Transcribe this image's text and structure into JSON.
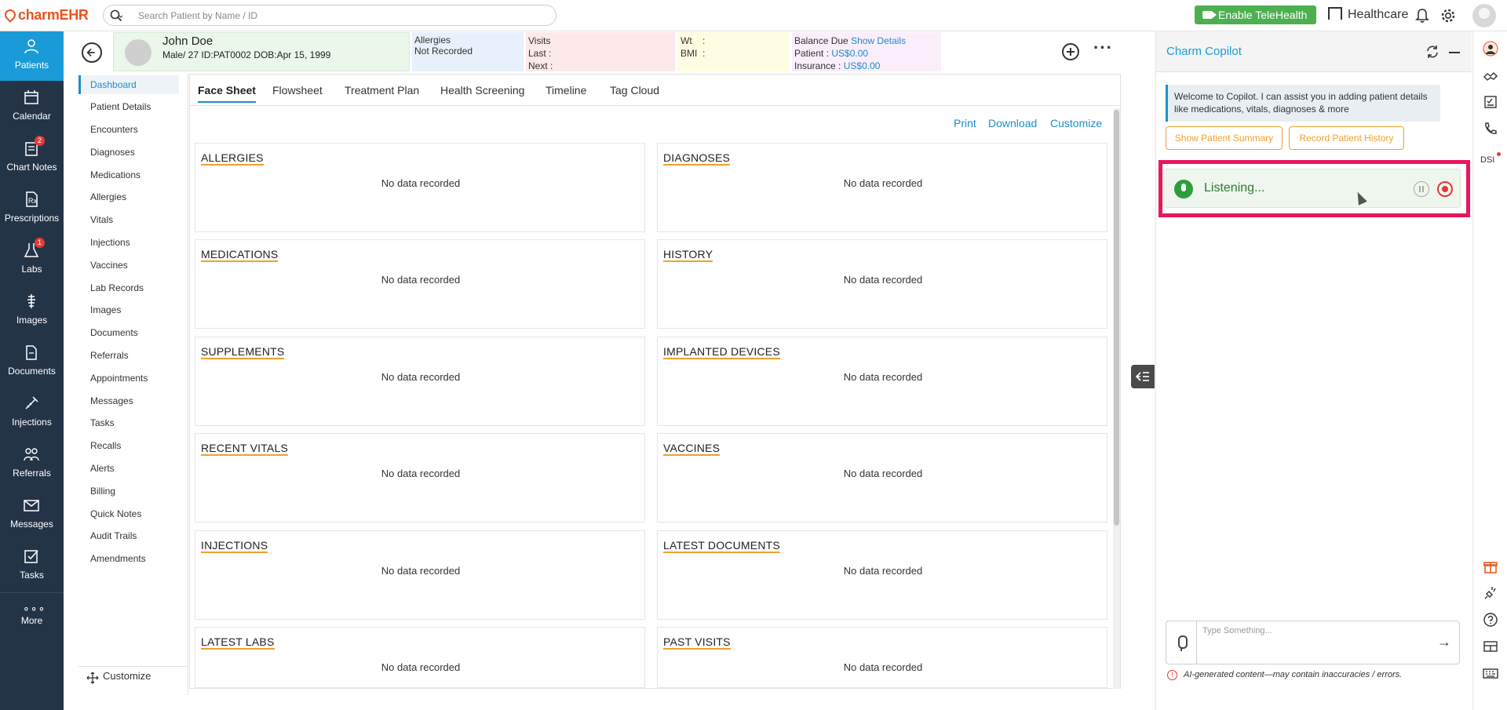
{
  "app": {
    "logo_text": "charmEHR",
    "org_name": "Healthcare"
  },
  "search": {
    "placeholder": "Search Patient by Name / ID"
  },
  "telehealth": {
    "label": "Enable TeleHealth"
  },
  "leftnav": {
    "items": [
      {
        "label": "Patients",
        "icon": "patients-icon",
        "badge": ""
      },
      {
        "label": "Calendar",
        "icon": "calendar-icon",
        "badge": ""
      },
      {
        "label": "Chart Notes",
        "icon": "chart-notes-icon",
        "badge": "2"
      },
      {
        "label": "Prescriptions",
        "icon": "prescriptions-icon",
        "badge": ""
      },
      {
        "label": "Labs",
        "icon": "labs-icon",
        "badge": "1"
      },
      {
        "label": "Images",
        "icon": "images-icon",
        "badge": ""
      },
      {
        "label": "Documents",
        "icon": "documents-icon",
        "badge": ""
      },
      {
        "label": "Injections",
        "icon": "injections-icon",
        "badge": ""
      },
      {
        "label": "Referrals",
        "icon": "referrals-icon",
        "badge": ""
      },
      {
        "label": "Messages",
        "icon": "messages-icon",
        "badge": ""
      },
      {
        "label": "Tasks",
        "icon": "tasks-icon",
        "badge": ""
      },
      {
        "label": "More",
        "icon": "more-icon",
        "badge": ""
      }
    ]
  },
  "patient": {
    "name": "John Doe",
    "meta": "Male/ 27  ID:PAT0002  DOB:Apr 15, 1999",
    "allergies_label": "Allergies",
    "allergies_value": "Not Recorded",
    "visits_label": "Visits",
    "last_label": "Last  :",
    "next_label": "Next :",
    "wt_label": "Wt    :",
    "bmi_label": "BMI  :",
    "balance_label": "Balance Due",
    "show_details": "Show Details",
    "patient_balance_label": "Patient :",
    "patient_balance": "US$0.00",
    "insurance_label": "Insurance :",
    "insurance_balance": "US$0.00"
  },
  "subnav": {
    "items": [
      "Dashboard",
      "Patient Details",
      "Encounters",
      "Diagnoses",
      "Medications",
      "Allergies",
      "Vitals",
      "Injections",
      "Vaccines",
      "Lab Records",
      "Images",
      "Documents",
      "Referrals",
      "Appointments",
      "Messages",
      "Tasks",
      "Recalls",
      "Alerts",
      "Billing",
      "Quick Notes",
      "Audit Trails",
      "Amendments"
    ],
    "customize": "Customize"
  },
  "tabs": [
    "Face Sheet",
    "Flowsheet",
    "Treatment Plan",
    "Health Screening",
    "Timeline",
    "Tag Cloud"
  ],
  "actions": {
    "print": "Print",
    "download": "Download",
    "customize": "Customize"
  },
  "cards": [
    {
      "title": "ALLERGIES",
      "empty": "No data recorded"
    },
    {
      "title": "DIAGNOSES",
      "empty": "No data recorded"
    },
    {
      "title": "MEDICATIONS",
      "empty": "No data recorded"
    },
    {
      "title": "HISTORY",
      "empty": "No data recorded"
    },
    {
      "title": "SUPPLEMENTS",
      "empty": "No data recorded"
    },
    {
      "title": "IMPLANTED DEVICES",
      "empty": "No data recorded"
    },
    {
      "title": "RECENT VITALS",
      "empty": "No data recorded"
    },
    {
      "title": "VACCINES",
      "empty": "No data recorded"
    },
    {
      "title": "INJECTIONS",
      "empty": "No data recorded"
    },
    {
      "title": "LATEST DOCUMENTS",
      "empty": "No data recorded"
    },
    {
      "title": "LATEST LABS",
      "empty": "No data recorded"
    },
    {
      "title": "PAST VISITS",
      "empty": "No data recorded"
    }
  ],
  "copilot": {
    "title": "Charm Copilot",
    "welcome": "Welcome to Copilot. I can assist you in adding patient details like medications, vitals, diagnoses & more",
    "btn_summary": "Show Patient Summary",
    "btn_history": "Record Patient History",
    "listening": "Listening...",
    "input_placeholder": "Type Something...",
    "disclaimer": "AI-generated content—may contain inaccuracies / errors."
  },
  "rightrail": {
    "dsi_label": "DSI"
  },
  "colors": {
    "nav_bg": "#243447",
    "accent": "#1a9bd7",
    "highlight": "#e8175d",
    "tele": "#4caf50"
  }
}
